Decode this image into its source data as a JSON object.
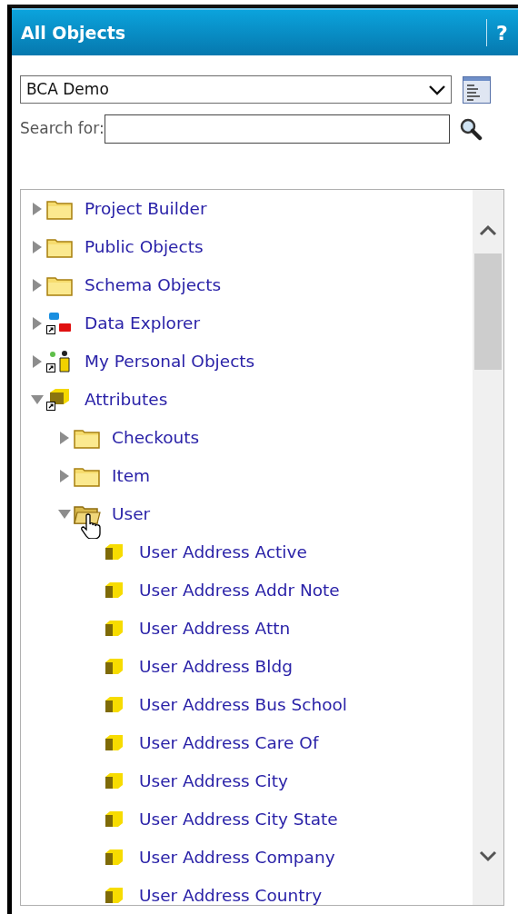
{
  "panel": {
    "title": "All Objects",
    "help": "?"
  },
  "project_select": {
    "value": "BCA Demo"
  },
  "search": {
    "label": "Search for:"
  },
  "tree": [
    {
      "label": "Project Builder",
      "kind": "folder",
      "expanded": false
    },
    {
      "label": "Public Objects",
      "kind": "folder",
      "expanded": false
    },
    {
      "label": "Schema Objects",
      "kind": "folder",
      "expanded": false
    },
    {
      "label": "Data Explorer",
      "kind": "explorer",
      "expanded": false
    },
    {
      "label": "My Personal Objects",
      "kind": "person",
      "expanded": false
    },
    {
      "label": "Attributes",
      "kind": "attribute-shortcut",
      "expanded": true,
      "children": [
        {
          "label": "Checkouts",
          "kind": "folder",
          "expanded": false
        },
        {
          "label": "Item",
          "kind": "folder",
          "expanded": false
        },
        {
          "label": "User",
          "kind": "folder",
          "expanded": true,
          "pointer_over": true,
          "children": [
            {
              "label": "User Address Active",
              "kind": "attribute"
            },
            {
              "label": "User Address Addr Note",
              "kind": "attribute"
            },
            {
              "label": "User Address Attn",
              "kind": "attribute"
            },
            {
              "label": "User Address Bldg",
              "kind": "attribute"
            },
            {
              "label": "User Address Bus School",
              "kind": "attribute"
            },
            {
              "label": "User Address Care Of",
              "kind": "attribute"
            },
            {
              "label": "User Address City",
              "kind": "attribute"
            },
            {
              "label": "User Address City State",
              "kind": "attribute"
            },
            {
              "label": "User Address Company",
              "kind": "attribute"
            },
            {
              "label": "User Address Country",
              "kind": "attribute"
            }
          ]
        }
      ]
    }
  ]
}
